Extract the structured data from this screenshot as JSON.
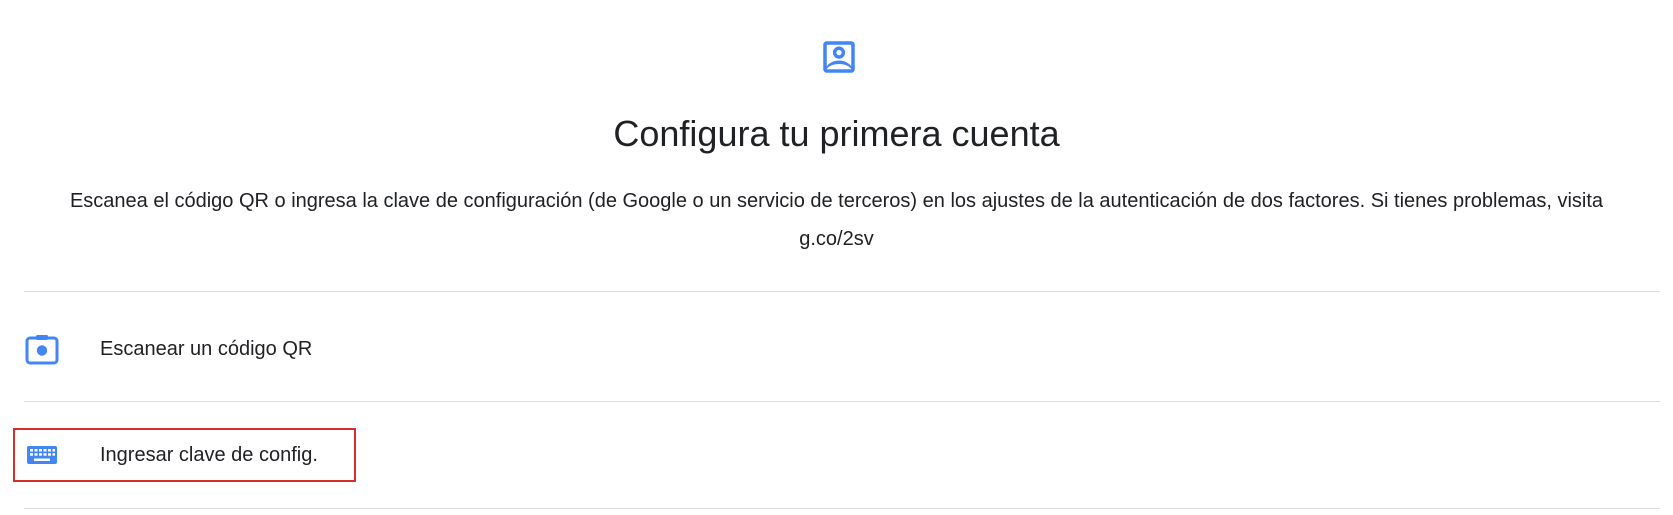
{
  "header": {
    "icon": "account-box-icon",
    "title": "Configura tu primera cuenta",
    "description": "Escanea el código QR o ingresa la clave de configuración (de Google o un servicio de terceros) en los ajustes de la autenticación de dos factores. Si tienes problemas, visita g.co/2sv"
  },
  "options": [
    {
      "icon": "camera-icon",
      "label": "Escanear un código QR"
    },
    {
      "icon": "keyboard-icon",
      "label": "Ingresar clave de config.",
      "highlighted": true
    }
  ],
  "colors": {
    "accent": "#4285f4",
    "text": "#202124",
    "divider": "#dcdcdc",
    "highlight_border": "#d32f2f"
  }
}
